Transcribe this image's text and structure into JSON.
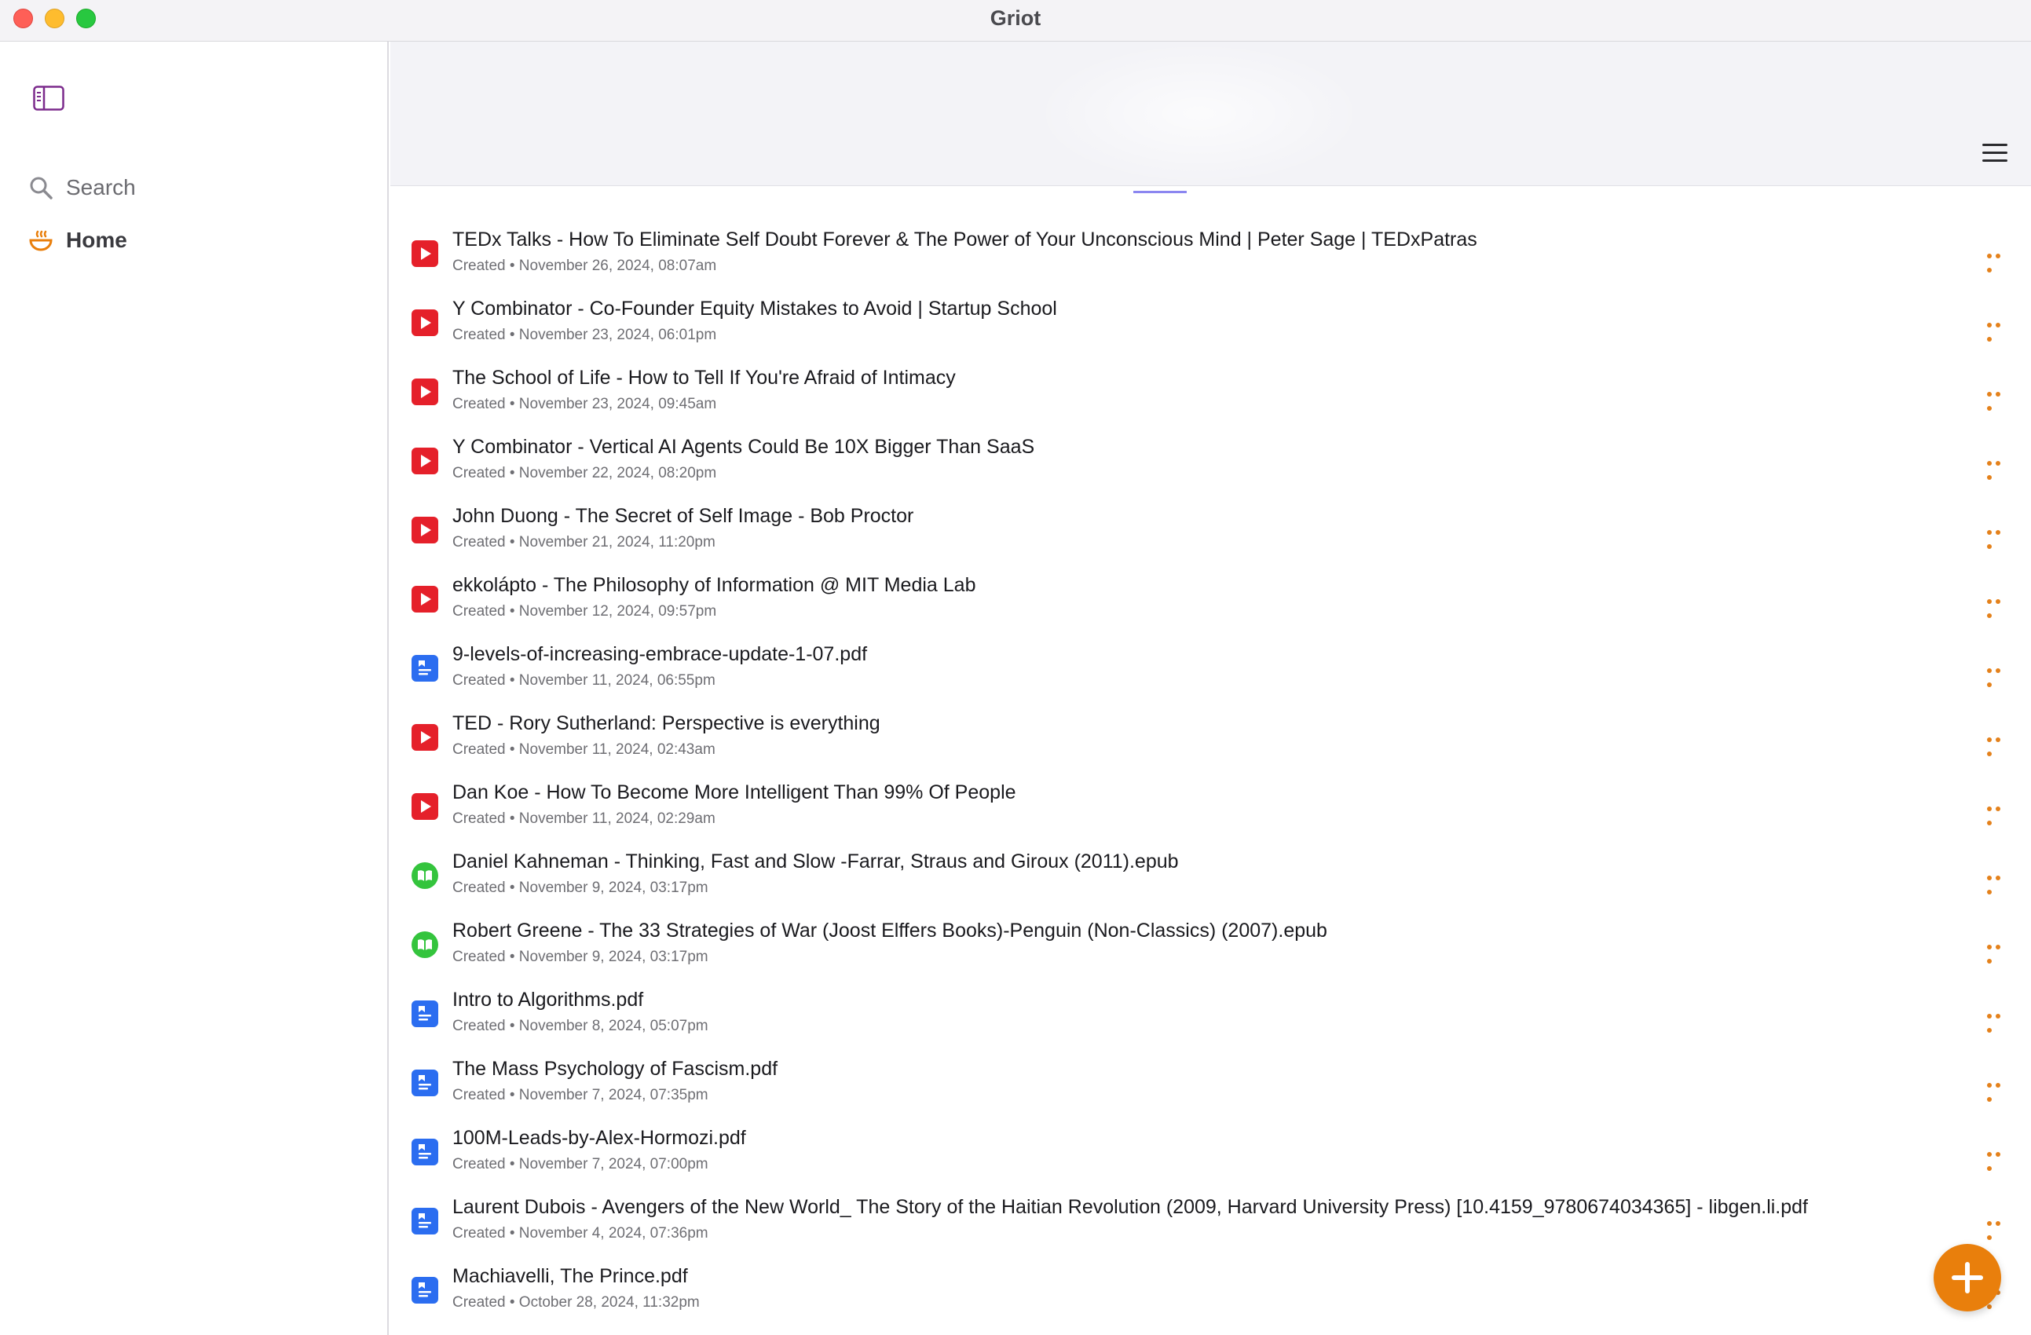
{
  "window": {
    "title": "Griot"
  },
  "sidebar": {
    "items": [
      {
        "label": "Search",
        "icon": "search-icon"
      },
      {
        "label": "Home",
        "icon": "home-bowl-icon"
      }
    ]
  },
  "colors": {
    "accent": "#e97f0c",
    "video": "#e5202a",
    "pdf": "#2b6df0",
    "book": "#34c43d"
  },
  "items": [
    {
      "title": "TEDx Talks - How To Eliminate Self Doubt Forever & The Power of Your Unconscious Mind | Peter Sage | TEDxPatras",
      "subtitle": "Created • November 26, 2024, 08:07am",
      "type": "video"
    },
    {
      "title": "Y Combinator - Co-Founder Equity Mistakes to Avoid | Startup School",
      "subtitle": "Created • November 23, 2024, 06:01pm",
      "type": "video"
    },
    {
      "title": "The School of Life - How to Tell If You're Afraid of Intimacy",
      "subtitle": "Created • November 23, 2024, 09:45am",
      "type": "video"
    },
    {
      "title": "Y Combinator - Vertical AI Agents Could Be 10X Bigger Than SaaS",
      "subtitle": "Created • November 22, 2024, 08:20pm",
      "type": "video"
    },
    {
      "title": "John Duong - The Secret of Self Image - Bob Proctor",
      "subtitle": "Created • November 21, 2024, 11:20pm",
      "type": "video"
    },
    {
      "title": "ekkolápto - The Philosophy of Information @ MIT Media Lab",
      "subtitle": "Created • November 12, 2024, 09:57pm",
      "type": "video"
    },
    {
      "title": "9-levels-of-increasing-embrace-update-1-07.pdf",
      "subtitle": "Created • November 11, 2024, 06:55pm",
      "type": "pdf"
    },
    {
      "title": "TED - Rory Sutherland: Perspective is everything",
      "subtitle": "Created • November 11, 2024, 02:43am",
      "type": "video"
    },
    {
      "title": "Dan Koe - How To Become More Intelligent Than 99% Of People",
      "subtitle": "Created • November 11, 2024, 02:29am",
      "type": "video"
    },
    {
      "title": "Daniel Kahneman - Thinking, Fast and Slow  -Farrar, Straus and Giroux (2011).epub",
      "subtitle": "Created • November 9, 2024, 03:17pm",
      "type": "book"
    },
    {
      "title": "Robert Greene - The 33 Strategies of War (Joost Elffers Books)-Penguin (Non-Classics) (2007).epub",
      "subtitle": "Created • November 9, 2024, 03:17pm",
      "type": "book"
    },
    {
      "title": "Intro to Algorithms.pdf",
      "subtitle": "Created • November 8, 2024, 05:07pm",
      "type": "pdf"
    },
    {
      "title": "The Mass Psychology of Fascism.pdf",
      "subtitle": "Created • November 7, 2024, 07:35pm",
      "type": "pdf"
    },
    {
      "title": "100M-Leads-by-Alex-Hormozi.pdf",
      "subtitle": "Created • November 7, 2024, 07:00pm",
      "type": "pdf"
    },
    {
      "title": "Laurent Dubois - Avengers of the New World_ The Story of the Haitian Revolution (2009, Harvard University Press) [10.4159_9780674034365] - libgen.li.pdf",
      "subtitle": "Created • November 4, 2024, 07:36pm",
      "type": "pdf"
    },
    {
      "title": "Machiavelli, The Prince.pdf",
      "subtitle": "Created • October 28, 2024, 11:32pm",
      "type": "pdf"
    }
  ]
}
